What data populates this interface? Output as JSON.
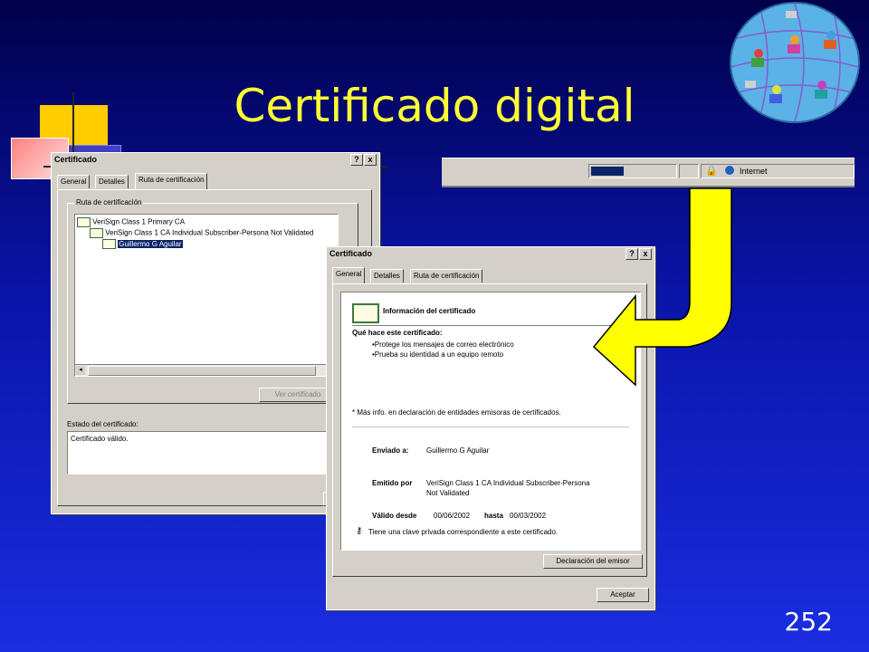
{
  "slide": {
    "title": "Certificado digital",
    "page_number": "252"
  },
  "status_bar": {
    "zone": "Internet"
  },
  "back_dialog": {
    "title": "Certificado",
    "help_btn": "?",
    "close_btn": "x",
    "tabs": [
      "General",
      "Detalles",
      "Ruta de certificación"
    ],
    "path_group_label": "Ruta de certificación",
    "tree": [
      "VeriSign Class 1 Primary CA",
      "VeriSign Class 1 CA Individual Subscriber-Persona Not Validated",
      "Guillermo G Aguilar"
    ],
    "view_button": "Ver certificado",
    "status_label": "Estado del certificado:",
    "status_value": "Certificado válido."
  },
  "front_dialog": {
    "title": "Certificado",
    "help_btn": "?",
    "close_btn": "x",
    "tabs": [
      "General",
      "Detalles",
      "Ruta de certificación"
    ],
    "info_heading": "Información del certificado",
    "purpose_heading": "Qué hace este certificado:",
    "purposes": [
      "•Protege los mensajes de correo electrónico",
      "•Prueba su identidad a un equipo remoto"
    ],
    "more_info": "* Más info. en declaración de entidades emisoras de certificados.",
    "issued_to_label": "Enviado a:",
    "issued_to_value": "Guillermo G Aguilar",
    "issued_by_label": "Emitido por",
    "issued_by_value_1": "VeriSign Class 1 CA Individual Subscriber-Persona",
    "issued_by_value_2": "Not Validated",
    "valid_from_label": "Válido desde",
    "valid_from_value": "00/06/2002",
    "valid_to_label": "hasta",
    "valid_to_value": "00/03/2002",
    "private_key_note": "Tiene una clave privada correspondiente a este certificado.",
    "issuer_statement_button": "Declaración del emisor",
    "ok_button": "Aceptar"
  }
}
